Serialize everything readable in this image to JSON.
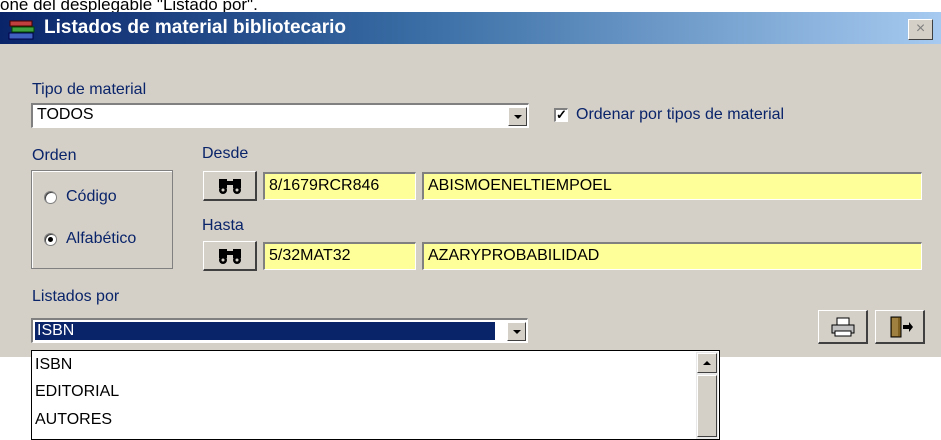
{
  "caption": "one del desplegable \"Listado por\".",
  "window": {
    "title": "Listados de material bibliotecario",
    "close_label": "×"
  },
  "tipo": {
    "label": "Tipo de material",
    "value": "TODOS"
  },
  "ordenar": {
    "label": "Ordenar por tipos de material",
    "checked": true,
    "check_glyph": "✓"
  },
  "orden": {
    "label": "Orden",
    "options": [
      "Código",
      "Alfabético"
    ],
    "selected": "Alfabético"
  },
  "desde": {
    "label": "Desde",
    "code": "8/1679RCR846",
    "title": "ABISMOENELTIEMPOEL"
  },
  "hasta": {
    "label": "Hasta",
    "code": "5/32MAT32",
    "title": "AZARYPROBABILIDAD"
  },
  "listados": {
    "label": "Listados por",
    "value": "ISBN",
    "options": [
      "ISBN",
      "EDITORIAL",
      "AUTORES"
    ]
  },
  "icons": {
    "search": "binoculars-icon",
    "print": "printer-icon",
    "exit": "exit-door-icon"
  }
}
